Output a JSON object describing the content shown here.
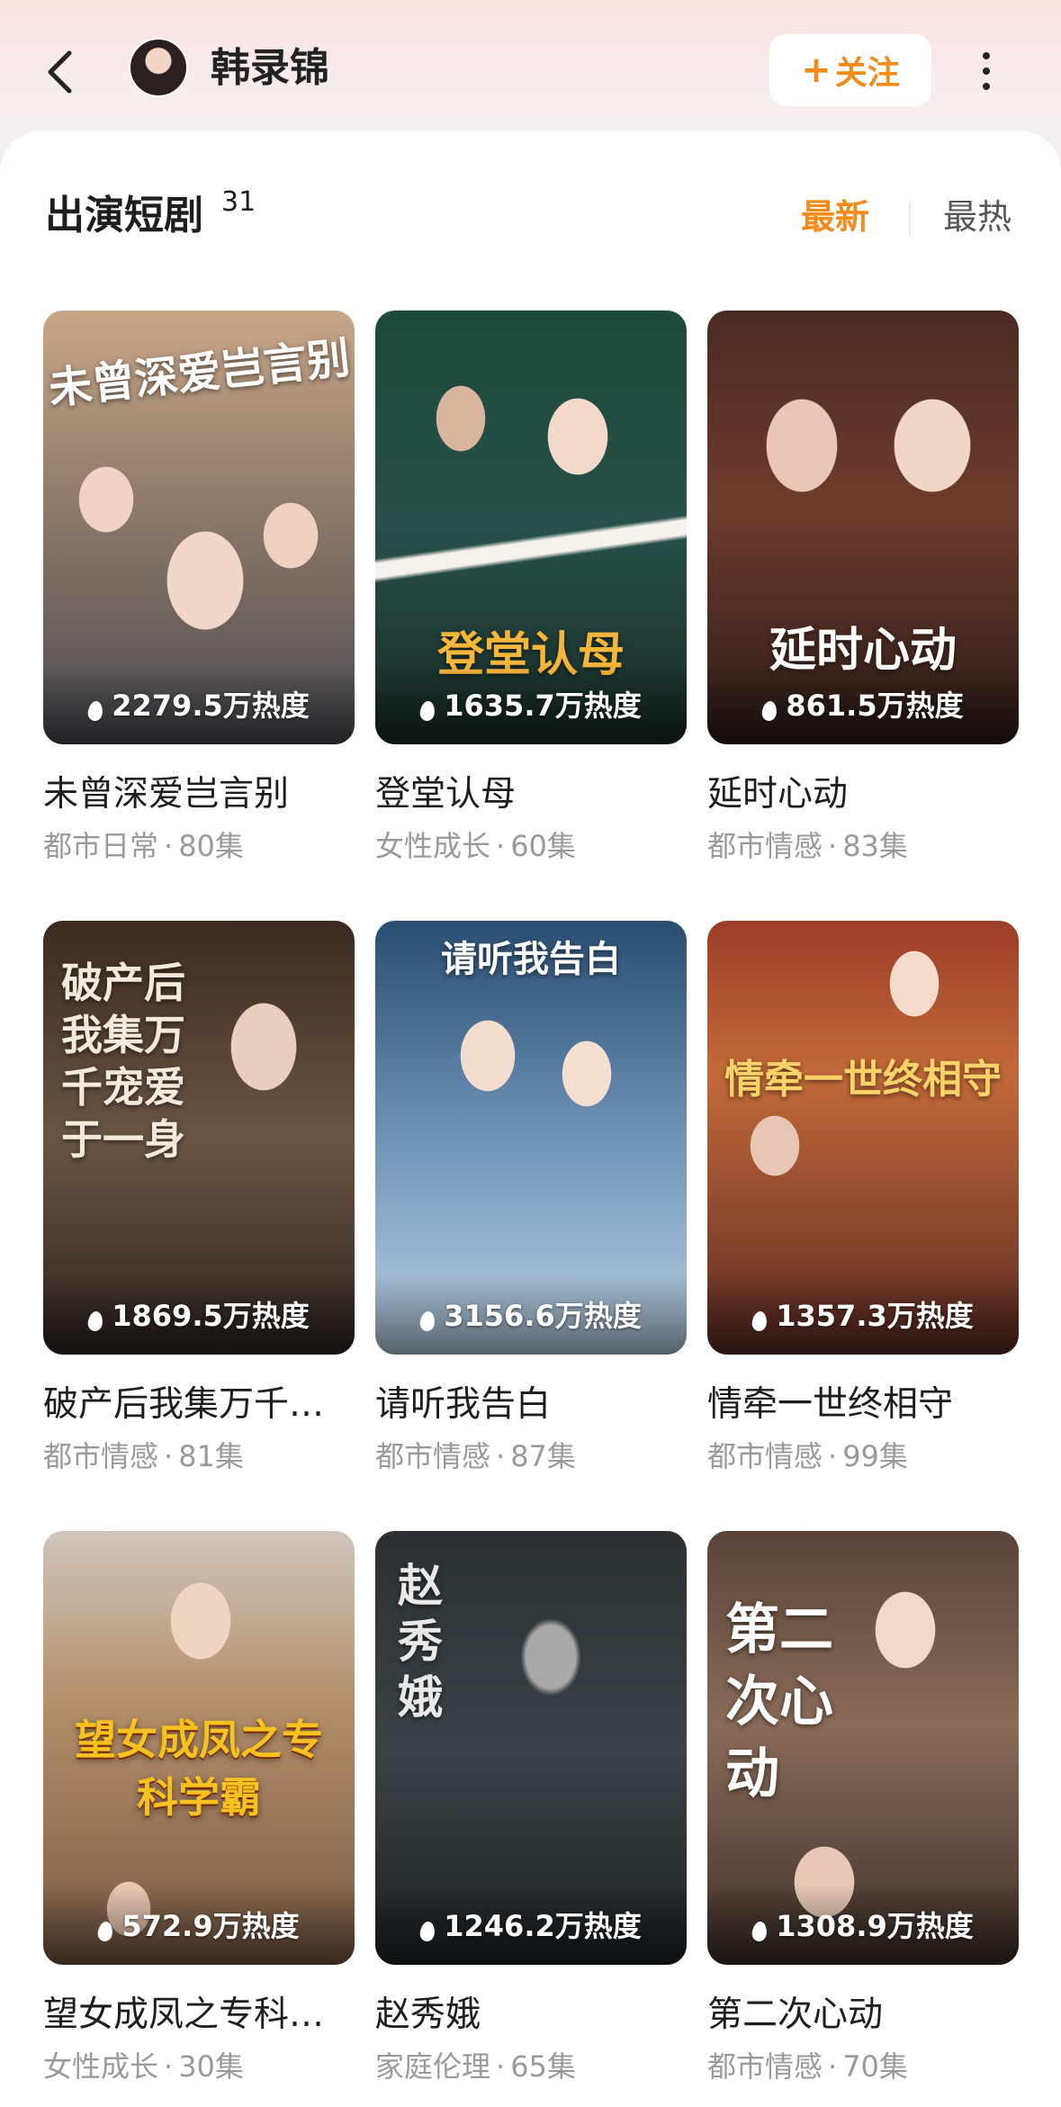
{
  "header": {
    "name": "韩录锦",
    "follow_plus": "+",
    "follow_label": "关注"
  },
  "section": {
    "title": "出演短剧",
    "count": "31",
    "sort_newest": "最新",
    "sort_hottest": "最热"
  },
  "colors": {
    "accent": "#f48a17",
    "title_text": "#1e1e1e",
    "meta_text": "#9a9a9a"
  },
  "dramas": [
    {
      "poster_text": "未曾深爱岂言别",
      "heat": "2279.5万热度",
      "title": "未曾深爱岂言别",
      "genre": "都市日常",
      "episodes": "80集"
    },
    {
      "poster_text": "登堂认母",
      "heat": "1635.7万热度",
      "title": "登堂认母",
      "genre": "女性成长",
      "episodes": "60集"
    },
    {
      "poster_text": "延时心动",
      "heat": "861.5万热度",
      "title": "延时心动",
      "genre": "都市情感",
      "episodes": "83集"
    },
    {
      "poster_text": "破产后我集万千宠爱于一身",
      "heat": "1869.5万热度",
      "title": "破产后我集万千…",
      "genre": "都市情感",
      "episodes": "81集"
    },
    {
      "poster_text": "请听我告白",
      "heat": "3156.6万热度",
      "title": "请听我告白",
      "genre": "都市情感",
      "episodes": "87集"
    },
    {
      "poster_text": "情牵一世终相守",
      "heat": "1357.3万热度",
      "title": "情牵一世终相守",
      "genre": "都市情感",
      "episodes": "99集"
    },
    {
      "poster_text": "望女成凤之专科学霸",
      "heat": "572.9万热度",
      "title": "望女成凤之专科…",
      "genre": "女性成长",
      "episodes": "30集"
    },
    {
      "poster_text": "赵秀娥",
      "heat": "1246.2万热度",
      "title": "赵秀娥",
      "genre": "家庭伦理",
      "episodes": "65集"
    },
    {
      "poster_text": "第二次心动",
      "heat": "1308.9万热度",
      "title": "第二次心动",
      "genre": "都市情感",
      "episodes": "70集"
    }
  ]
}
